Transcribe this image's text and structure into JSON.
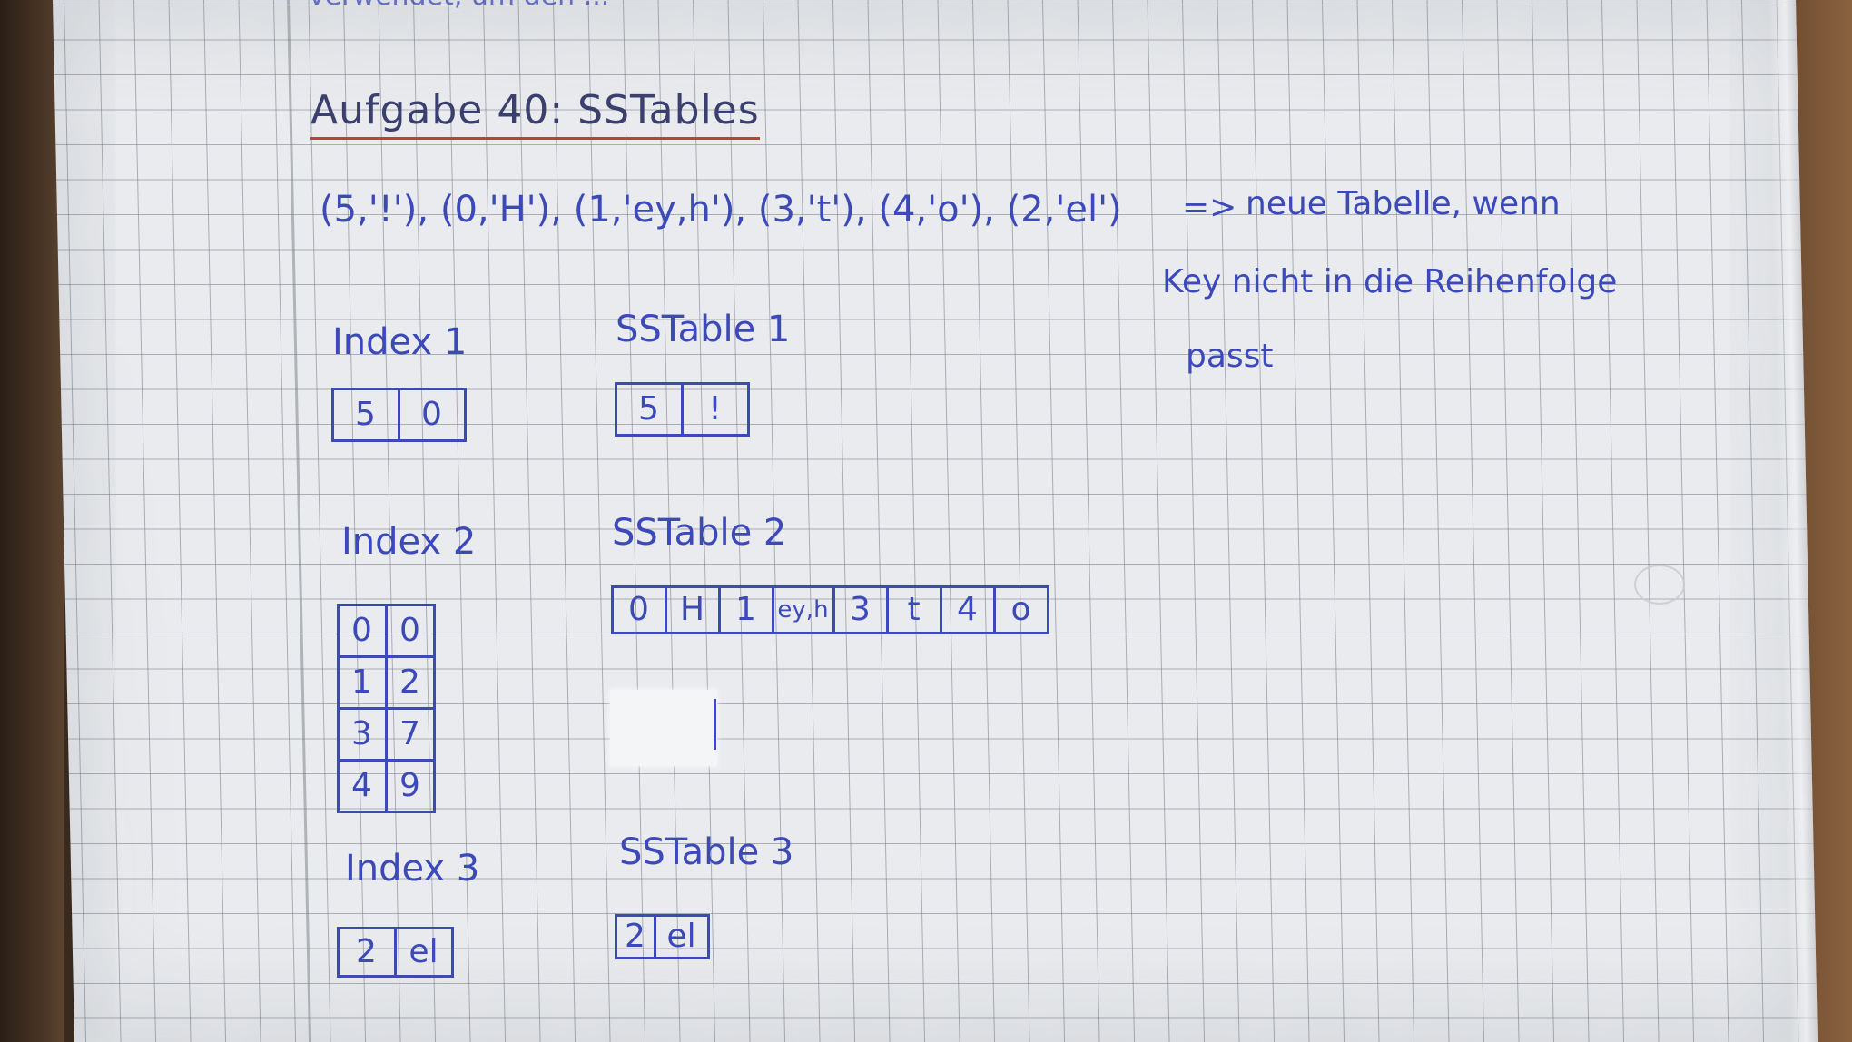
{
  "title": "Aufgabe 40: SSTables",
  "top_partial_text": "verwendet, um den ...",
  "tuples_line": "(5,'!'), (0,'H'), (1,'ey,h'), (3,'t'), (4,'o'), (2,'el')",
  "arrow": "=>",
  "note": {
    "line1": "neue Tabelle, wenn",
    "line2": "Key nicht in die Reihenfolge",
    "line3": "passt"
  },
  "index1": {
    "label": "Index 1",
    "cells": [
      "5",
      "0"
    ]
  },
  "sstable1": {
    "label": "SSTable 1",
    "cells": [
      "5",
      "!"
    ]
  },
  "index2": {
    "label": "Index 2",
    "rows": [
      [
        "0",
        "0"
      ],
      [
        "1",
        "2"
      ],
      [
        "3",
        "7"
      ],
      [
        "4",
        "9"
      ]
    ]
  },
  "sstable2": {
    "label": "SSTable 2",
    "cells": [
      "0",
      "H",
      "1",
      "ey,h",
      "3",
      "t",
      "4",
      "o"
    ]
  },
  "index3": {
    "label": "Index 3",
    "cells": [
      "2",
      "el"
    ]
  },
  "sstable3": {
    "label": "SSTable 3",
    "cells": [
      "2",
      "el"
    ]
  },
  "colors": {
    "ink": "#3c49b8",
    "underline": "#b8452f",
    "paper": "#e9ebee",
    "grid": "#767a82"
  }
}
